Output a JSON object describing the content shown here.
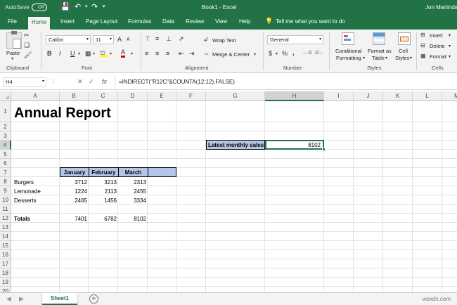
{
  "titlebar": {
    "autosave": "AutoSave",
    "autosave_state": "Off",
    "title": "Book1  -  Excel",
    "user": "Jon Martinda"
  },
  "tabs": [
    "File",
    "Home",
    "Insert",
    "Page Layout",
    "Formulas",
    "Data",
    "Review",
    "View",
    "Help"
  ],
  "tell_me": "Tell me what you want to do",
  "ribbon": {
    "clipboard": {
      "label": "Clipboard",
      "paste": "Paste"
    },
    "font": {
      "label": "Font",
      "name": "Calibri",
      "size": "11",
      "bold": "B",
      "italic": "I",
      "underline": "U",
      "grow": "A",
      "shrink": "A",
      "color": "A"
    },
    "alignment": {
      "label": "Alignment",
      "wrap": "Wrap Text",
      "merge": "Merge & Center"
    },
    "number": {
      "label": "Number",
      "format": "General",
      "currency": "$",
      "percent": "%",
      "comma": ","
    },
    "styles": {
      "label": "Styles",
      "conditional": "Conditional",
      "formatting": "Formatting",
      "format_as": "Format as",
      "table": "Table",
      "cell": "Cell",
      "cell_styles": "Styles"
    },
    "cells": {
      "label": "Cells",
      "insert": "Insert",
      "delete": "Delete",
      "format": "Format"
    }
  },
  "formula_bar": {
    "name_box": "H4",
    "fx": "fx",
    "formula": "=INDIRECT(\"R12C\"&COUNTA(12:12),FALSE)"
  },
  "columns": [
    "A",
    "B",
    "C",
    "D",
    "E",
    "F",
    "G",
    "H",
    "I",
    "J",
    "K",
    "L",
    "M"
  ],
  "rows": [
    "1",
    "2",
    "3",
    "4",
    "5",
    "6",
    "7",
    "8",
    "9",
    "10",
    "11",
    "12",
    "13",
    "14",
    "15",
    "16",
    "17",
    "18",
    "19",
    "20"
  ],
  "selected_cell": {
    "col": "H",
    "row": "4"
  },
  "sheet": {
    "title": "Annual Report",
    "latest_label": "Latest monthly sales",
    "latest_value": "8102",
    "headers": [
      "January",
      "February",
      "March"
    ],
    "data": [
      {
        "label": "Burgers",
        "values": [
          "3712",
          "3213",
          "2313"
        ]
      },
      {
        "label": "Lemonade",
        "values": [
          "1224",
          "2113",
          "2455"
        ]
      },
      {
        "label": "Desserts",
        "values": [
          "2465",
          "1456",
          "3334"
        ]
      }
    ],
    "totals": {
      "label": "Totals",
      "values": [
        "7401",
        "6782",
        "8102"
      ]
    }
  },
  "sheet_tabs": {
    "active": "Sheet1",
    "add": "+"
  },
  "watermark": "wsxdn.com",
  "colors": {
    "excel_green": "#217346",
    "header_fill": "#b4c6e7",
    "selected_header": "#d2d2d2"
  }
}
